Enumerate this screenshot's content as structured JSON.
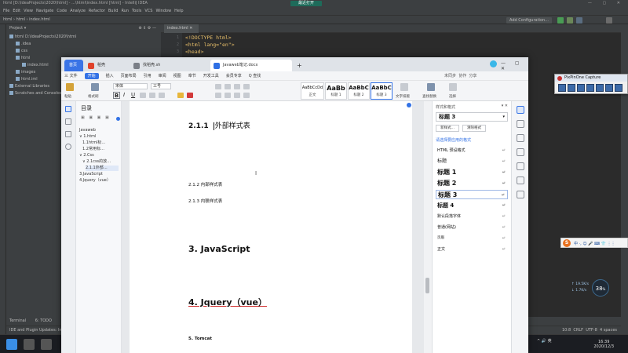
{
  "ide": {
    "title": "html [D:\\IdeaProjects\\2020\\html] - ...\\html\\index.html [html] - IntelliJ IDEA",
    "center_badge": "最近打开",
    "menu": [
      "File",
      "Edit",
      "View",
      "Navigate",
      "Code",
      "Analyze",
      "Refactor",
      "Build",
      "Run",
      "Tools",
      "VCS",
      "Window",
      "Help"
    ],
    "breadcrumb": [
      "html",
      "html",
      "index.html"
    ],
    "add_config": "Add Configuration...",
    "project_header": "Project",
    "tree": [
      {
        "label": "html D:\\IdeaProjects\\2020\\html",
        "indent": 0
      },
      {
        "label": ".idea",
        "indent": 1
      },
      {
        "label": "css",
        "indent": 1
      },
      {
        "label": "html",
        "indent": 1
      },
      {
        "label": "index.html",
        "indent": 2
      },
      {
        "label": "images",
        "indent": 1
      },
      {
        "label": "html.iml",
        "indent": 1
      },
      {
        "label": "External Libraries",
        "indent": 0
      },
      {
        "label": "Scratches and Consoles",
        "indent": 0
      }
    ],
    "editor_tab": "index.html",
    "code": [
      "<!DOCTYPE html>",
      "<html lang=\"en\">",
      "<head>"
    ],
    "bottom_tabs": [
      "Terminal",
      "6: TODO"
    ],
    "status_left": "IDE and Plugin Updates: IntelliJ IDEA is ready to update. (today 16:36)",
    "status_right": [
      "10:8",
      "CRLF",
      "UTF-8",
      "4 spaces"
    ]
  },
  "wps": {
    "tabs": [
      {
        "label": "首页",
        "active": true,
        "color": "#2f6fe4"
      },
      {
        "label": "稻壳",
        "active": false,
        "color": "#e0422b"
      },
      {
        "label": "找稻壳.sh",
        "active": false,
        "color": "#7a7f87"
      },
      {
        "label": "Javaweb笔记.docx",
        "active": false,
        "color": "#2f6fe4"
      }
    ],
    "new_tab": "+",
    "menu": [
      "三 文件",
      "开始",
      "插入",
      "页面布局",
      "引用",
      "审阅",
      "视图",
      "章节",
      "开发工具",
      "会员专享",
      "Q 查找"
    ],
    "menu_active_index": 1,
    "right_menu": [
      "未同步",
      "协作",
      "分享"
    ],
    "toolbar": {
      "paste": "粘贴",
      "format_painter": "格式刷",
      "font_name": "宋体",
      "font_size": "三号",
      "bold": "B",
      "italic": "I",
      "underline": "U",
      "styles": [
        {
          "big": "AaBbCcDd",
          "small": "正文"
        },
        {
          "big": "AaBb",
          "small": "标题 1"
        },
        {
          "big": "AaBbC",
          "small": "标题 2"
        },
        {
          "big": "AaBbC",
          "small": "标题 3"
        }
      ],
      "text_layout": "文字排版",
      "find_replace": "查找替换",
      "select": "选择"
    },
    "outline": {
      "title": "目录",
      "items": [
        {
          "label": "Javaweb",
          "indent": 0
        },
        {
          "label": "∨ 1.html",
          "indent": 0
        },
        {
          "label": "1.1html标…",
          "indent": 1
        },
        {
          "label": "1.2常用标…",
          "indent": 1
        },
        {
          "label": "∨ 2.Css",
          "indent": 0
        },
        {
          "label": "∨ 2.1css的放…",
          "indent": 1
        },
        {
          "label": "2.1.1外部…",
          "indent": 2
        },
        {
          "label": "3.JavaScript",
          "indent": 0
        },
        {
          "label": "4.Jquery（vue）",
          "indent": 0
        }
      ]
    },
    "document": {
      "h3_1": "2.1.1",
      "h3_1_text": "外部样式表",
      "h3_2": "2.1.2  内部样式表",
      "h3_3": "2.1.3  内联样式表",
      "h1_3": "3.  JavaScript",
      "h1_4": "4.  Jquery（vue）",
      "h1_5": "5.  Tomcat"
    },
    "style_pane": {
      "header": "样式和格式",
      "current": "标题 3",
      "new_btn": "新样式...",
      "clear_btn": "清除格式",
      "section": "请选择要应用的格式",
      "items": [
        {
          "label": "HTML 预设格式",
          "size": 5,
          "bold": false
        },
        {
          "label": "标题",
          "size": 6,
          "bold": false
        },
        {
          "label": "标题 1",
          "size": 8,
          "bold": true
        },
        {
          "label": "标题 2",
          "size": 8,
          "bold": true
        },
        {
          "label": "标题 3",
          "size": 8,
          "bold": true,
          "selected": true
        },
        {
          "label": "标题 4",
          "size": 7,
          "bold": true
        },
        {
          "label": "默认段落字体",
          "size": 5,
          "bold": false
        },
        {
          "label": "普通(网站)",
          "size": 5,
          "bold": false
        },
        {
          "label": "页眉",
          "size": 4.5,
          "bold": false
        },
        {
          "label": "正文",
          "size": 5,
          "bold": false
        }
      ]
    }
  },
  "widgets": {
    "pp_capture_title": "PixPinOne Capture",
    "ime": "S",
    "ime_icons": "中 ·, ☺ 🎤 ⌨ 👕 ⋮⋮",
    "net_value": "38",
    "net_unit": "%",
    "rate_up": "↑ 19.5K/s",
    "rate_down": "↓ 1.7K/s"
  },
  "taskbar": {
    "tray_text": "^ 🔊 英",
    "time": "16:39",
    "date": "2020/12/3"
  },
  "colors": {
    "ide_bg": "#2b2b2b",
    "ide_panel": "#3c3f41",
    "wps_accent": "#3372e6",
    "code_tag": "#e8bf6a"
  }
}
